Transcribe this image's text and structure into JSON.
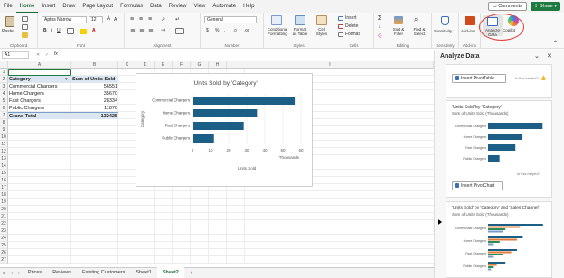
{
  "menu": {
    "tabs": [
      "File",
      "Home",
      "Insert",
      "Draw",
      "Page Layout",
      "Formulas",
      "Data",
      "Review",
      "View",
      "Automate",
      "Help"
    ],
    "comments_label": "Comments",
    "share_label": "Share"
  },
  "ribbon": {
    "paste_label": "Paste",
    "clipboard_label": "Clipboard",
    "font_name": "Aptos Narrow",
    "font_size": "12",
    "font_label": "Font",
    "alignment_label": "Alignment",
    "number_format": "General",
    "number_label": "Number",
    "cond_format_label": "Conditional Formatting",
    "format_table_label": "Format as Table",
    "cell_styles_label": "Cell Styles",
    "styles_label": "Styles",
    "insert_label": "Insert",
    "delete_label": "Delete",
    "format_label": "Format",
    "cells_label": "Cells",
    "sort_label": "Sort & Filter",
    "find_label": "Find & Select",
    "editing_label": "Editing",
    "sensitivity_label": "Sensitivity",
    "sensitivity_group": "Sensitivity",
    "addins_label": "Add-ins",
    "addins_group": "Add-ins",
    "analyze_label": "Analyze Data",
    "copilot_label": "Copilot",
    "accent_green": "#1e7a3e",
    "highlight_red": "#e0403a"
  },
  "formula_bar": {
    "name_box": "A1",
    "fx_label": "fx",
    "formula": ""
  },
  "columns": [
    "A",
    "B",
    "C",
    "D",
    "E",
    "F",
    "G",
    "H",
    "I"
  ],
  "rows": [
    "1",
    "2",
    "3",
    "4",
    "5",
    "6",
    "7",
    "8",
    "9",
    "10",
    "11",
    "12",
    "13",
    "14",
    "15",
    "16",
    "17",
    "18",
    "19",
    "20",
    "21",
    "22",
    "23",
    "24",
    "25",
    "26",
    "27"
  ],
  "pivot": {
    "header_category": "Category",
    "header_sum": "Sum of Units Sold",
    "rows": [
      {
        "category": "Commercial Chargers",
        "value": "56551"
      },
      {
        "category": "Home Chargers",
        "value": "35670"
      },
      {
        "category": "Fast Chargers",
        "value": "28334"
      },
      {
        "category": "Public Chargers",
        "value": "11870"
      }
    ],
    "total_label": "Grand Total",
    "total_value": "132425",
    "header_fill": "#dce6f1"
  },
  "chart_data": {
    "type": "bar",
    "title": "'Units Sold' by 'Category'",
    "categories": [
      "Commercial Chargers",
      "Home Chargers",
      "Fast Chargers",
      "Public Chargers"
    ],
    "values": [
      56.551,
      35.67,
      28.334,
      11.87
    ],
    "xlabel": "Units Sold",
    "ylabel": "Category",
    "units_label": "Thousands",
    "xlim": [
      0,
      60
    ],
    "xticks": [
      "0",
      "10",
      "20",
      "30",
      "40",
      "50",
      "60"
    ],
    "bar_color": "#1b5e86"
  },
  "panel": {
    "title": "Analyze Data",
    "insert_pivot_table": "Insert PivotTable",
    "helpful_1": "Is this helpful?",
    "card1_title": "'Units Sold' by 'Category'",
    "card1_sub": "Sum of Units Sold (Thousands)",
    "card1_cats": [
      "Commercial Chargers",
      "Home Chargers",
      "Fast Chargers",
      "Public Chargers"
    ],
    "card1_values": [
      56.551,
      35.67,
      28.334,
      11.87
    ],
    "helpful_2": "Is this helpful?",
    "insert_pivot_chart": "Insert PivotChart",
    "card2_title": "'Units Sold' by 'Category' and 'Sales Channel'",
    "card2_sub": "Sum of Units Sold (Thousands)",
    "card2_cats": [
      "Commercial Chargers",
      "Home Chargers",
      "Fast Chargers",
      "Public Chargers"
    ]
  },
  "sheets": {
    "tabs": [
      "Prices",
      "Reviews",
      "Existing Customers",
      "Sheet1",
      "Sheet2"
    ],
    "active": "Sheet2",
    "add_label": "+"
  }
}
